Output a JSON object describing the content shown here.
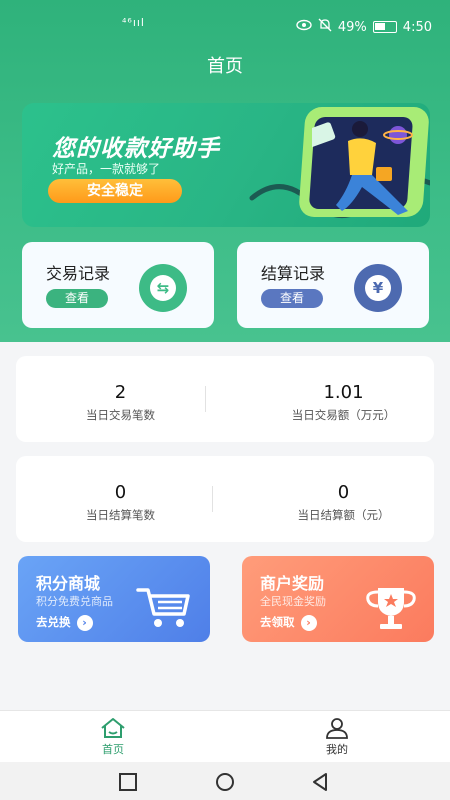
{
  "status_bar": {
    "signal": "⁴⁶ııl",
    "battery_text": "49%",
    "time": "4:50"
  },
  "page": {
    "title": "首页"
  },
  "banner": {
    "title": "您的收款好助手",
    "subtitle": "好产品，一款就够了",
    "button_label": "安全稳定"
  },
  "records": [
    {
      "label": "交易记录",
      "button": "查看",
      "icon": "exchange-icon",
      "color": "#3dbb86"
    },
    {
      "label": "结算记录",
      "button": "查看",
      "icon": "yen-icon",
      "color": "#4d6ab0"
    }
  ],
  "stats_trade": [
    {
      "value": "2",
      "label": "当日交易笔数"
    },
    {
      "value": "1.01",
      "label": "当日交易额（万元）"
    }
  ],
  "stats_settle": [
    {
      "value": "0",
      "label": "当日结算笔数"
    },
    {
      "value": "0",
      "label": "当日结算额（元）"
    }
  ],
  "promos": [
    {
      "title": "积分商城",
      "subtitle": "积分免费兑商品",
      "action": "去兑换",
      "icon": "shopping-cart-icon"
    },
    {
      "title": "商户奖励",
      "subtitle": "全民现金奖励",
      "action": "去领取",
      "icon": "trophy-icon"
    }
  ],
  "tabbar": [
    {
      "label": "首页",
      "icon": "home-icon",
      "active": true,
      "color": "#2e9e6e"
    },
    {
      "label": "我的",
      "icon": "user-icon",
      "active": false,
      "color": "#333333"
    }
  ],
  "colors": {
    "brand": "#2fb27b",
    "promo_blue": "#5b8ff0",
    "promo_orange": "#ff8a6b"
  }
}
